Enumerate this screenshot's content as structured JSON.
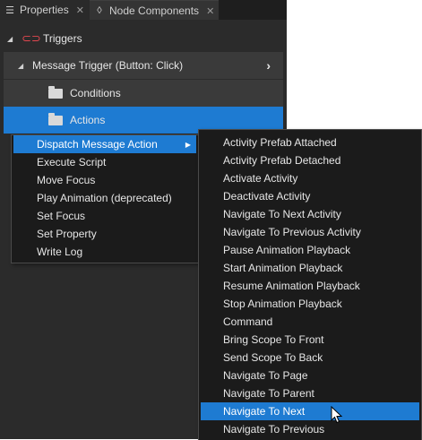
{
  "tabs": [
    {
      "label": "Properties",
      "icon": "list-icon",
      "close": "✕"
    },
    {
      "label": "Node Components",
      "icon": "component-icon",
      "close": "✕"
    }
  ],
  "tree": {
    "triggers_label": "Triggers",
    "message_trigger_label": "Message Trigger (Button: Click)",
    "conditions_label": "Conditions",
    "actions_label": "Actions"
  },
  "menu_main": {
    "items": [
      "Dispatch Message Action",
      "Execute Script",
      "Move Focus",
      "Play Animation (deprecated)",
      "Set Focus",
      "Set Property",
      "Write Log"
    ]
  },
  "menu_sub": {
    "items": [
      "Activity Prefab Attached",
      "Activity Prefab Detached",
      "Activate Activity",
      "Deactivate Activity",
      "Navigate To Next Activity",
      "Navigate To Previous Activity",
      "Pause Animation Playback",
      "Start Animation Playback",
      "Resume Animation Playback",
      "Stop Animation Playback",
      "Command",
      "Bring Scope To Front",
      "Send Scope To Back",
      "Navigate To Page",
      "Navigate To Parent",
      "Navigate To Next",
      "Navigate To Previous"
    ]
  },
  "colors": {
    "accent": "#1e7bd2",
    "trigger_icon": "#e0474f"
  }
}
